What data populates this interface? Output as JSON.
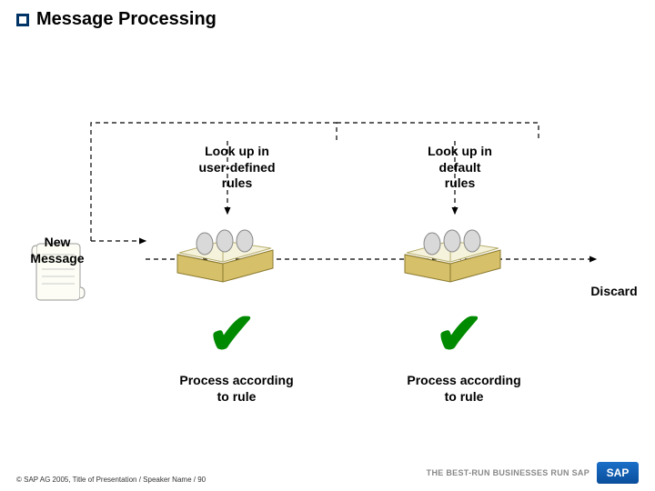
{
  "title": "Message Processing",
  "labels": {
    "lookup_user": "Look up in\nuser-defined\nrules",
    "lookup_default": "Look up in\ndefault\nrules",
    "new_message": "New\nMessage",
    "discard": "Discard",
    "process_left": "Process according\nto rule",
    "process_right": "Process according\nto rule"
  },
  "checks": {
    "left": "✔",
    "right": "✔"
  },
  "footer": {
    "copyright": "© SAP AG 2005, Title of Presentation / Speaker Name / 90",
    "tagline": "THE BEST-RUN BUSINESSES RUN SAP",
    "logo": "SAP"
  }
}
